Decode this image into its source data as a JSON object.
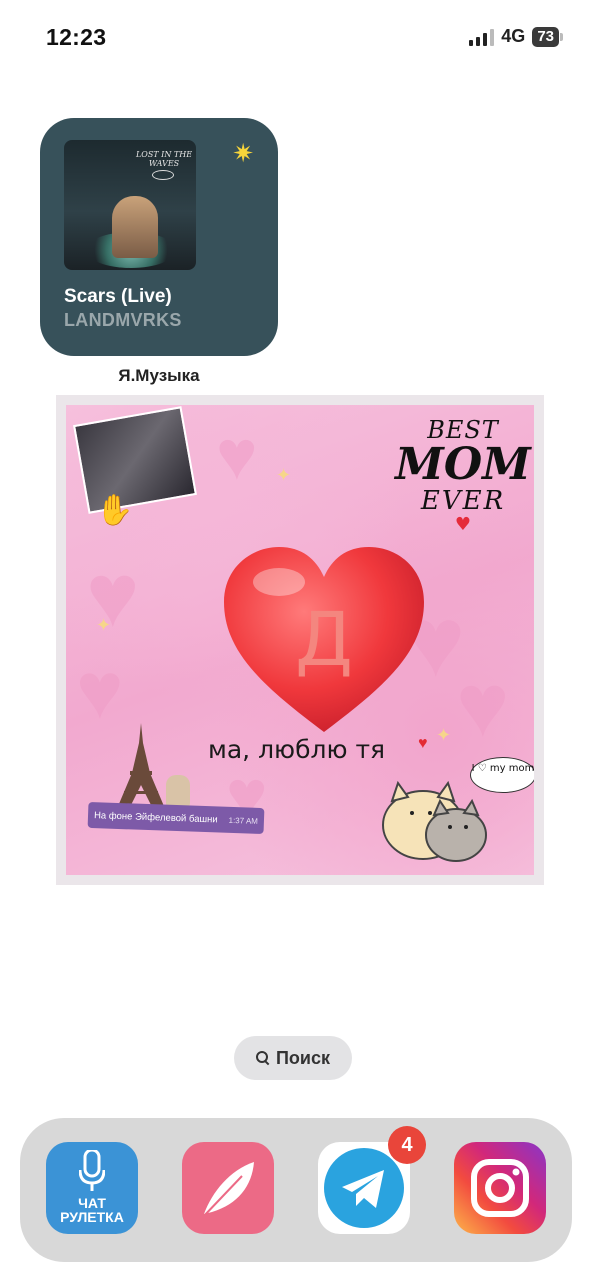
{
  "status_bar": {
    "time": "12:23",
    "network": "4G",
    "battery": "73"
  },
  "music_widget": {
    "track": "Scars (Live)",
    "artist": "LANDMVRKS",
    "album_art_text": "LOST IN THE WAVES",
    "label": "Я.Музыка"
  },
  "photo_widget": {
    "letter": "Д",
    "caption": "ма, люблю тя",
    "sticker_best": "BEST",
    "sticker_mom": "MOM",
    "sticker_ever": "EVER",
    "message_text": "На фоне Эйфелевой башни",
    "message_time": "1:37 AM",
    "bubble_text": "I ♡ my mom"
  },
  "search": {
    "label": "Поиск"
  },
  "dock": {
    "apps": [
      {
        "name": "ЧАТ РУЛЕТКА",
        "line1": "ЧАТ",
        "line2": "РУЛЕТКА",
        "color": "#3b93d6"
      },
      {
        "name": "Feather",
        "color": "#ec6a86"
      },
      {
        "name": "Telegram",
        "badge": "4",
        "color": "#2aa3df"
      },
      {
        "name": "Instagram",
        "color": "#d2287a"
      }
    ]
  }
}
